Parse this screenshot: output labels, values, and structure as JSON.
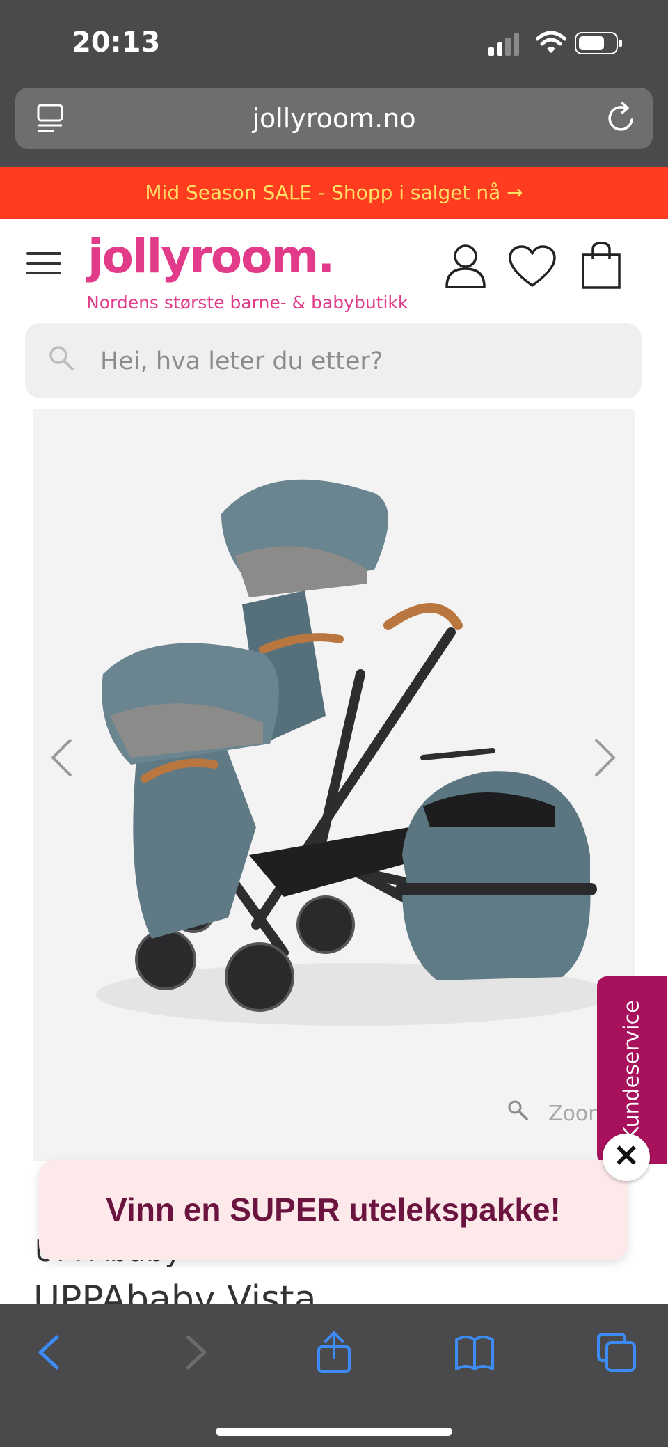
{
  "status_bar": {
    "time": "20:13"
  },
  "browser": {
    "url": "jollyroom.no"
  },
  "promo_banner": {
    "text": "Mid Season SALE - Shopp i salget nå →",
    "background": "#ff3c1f",
    "text_color": "#ffe067"
  },
  "header": {
    "logo": "jollyroom.",
    "tagline": "Nordens største barne- & babybutikk",
    "brand_color": "#e23b8a"
  },
  "search": {
    "placeholder": "Hei, hva leter du etter?",
    "value": ""
  },
  "gallery": {
    "zoom_label": "Zoom"
  },
  "customer_service_tab": {
    "label": "Kundeservice",
    "color": "#a8125d"
  },
  "popup": {
    "text": "Vinn en SUPER utelekspakke!"
  },
  "product": {
    "brand": "UPPAbaby",
    "title": "UPPAbaby Vista"
  },
  "icons": [
    "reader-icon",
    "reload-icon",
    "hamburger-icon",
    "user-icon",
    "heart-icon",
    "bag-icon",
    "search-icon",
    "chevron-left-icon",
    "chevron-right-icon",
    "zoom-icon",
    "close-icon",
    "back-icon",
    "forward-icon",
    "share-icon",
    "bookmarks-icon",
    "tabs-icon"
  ]
}
